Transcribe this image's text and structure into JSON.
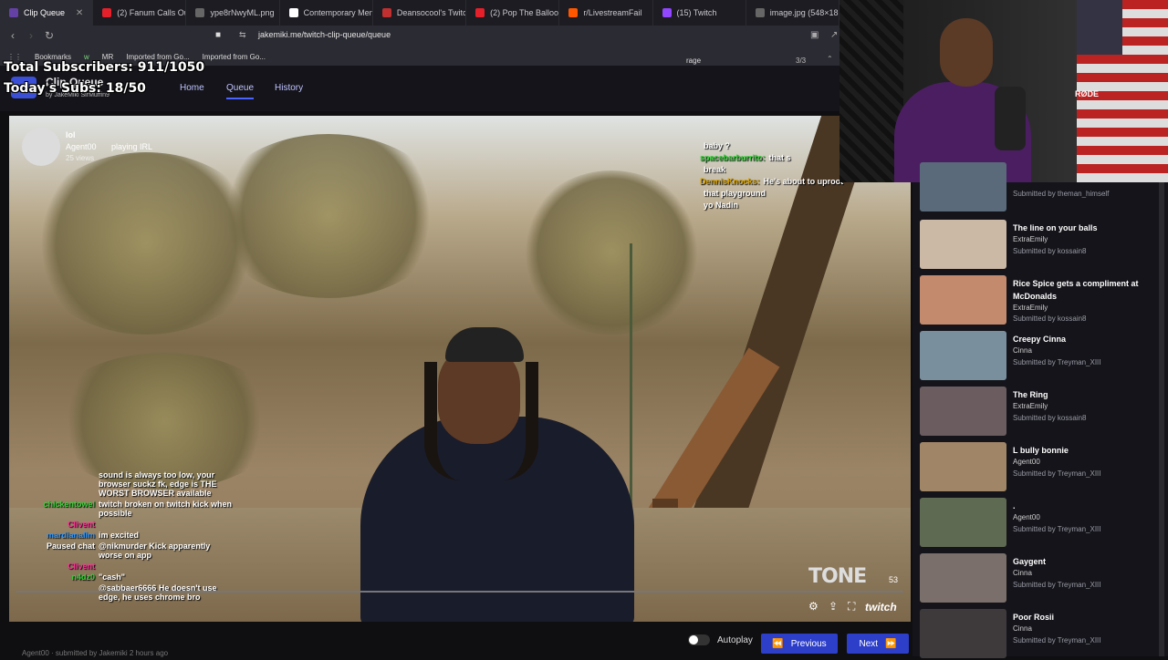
{
  "browser": {
    "tabs": [
      {
        "label": "Clip Queue",
        "color": "#6441a5",
        "active": true
      },
      {
        "label": "(2) Fanum Calls Out",
        "color": "#e5202a"
      },
      {
        "label": "ype8rNwyML.png",
        "color": "#666"
      },
      {
        "label": "Contemporary Men",
        "color": "#ffffff"
      },
      {
        "label": "Deansocool's Twitc",
        "color": "#c03030"
      },
      {
        "label": "(2) Pop The Balloon",
        "color": "#e5202a"
      },
      {
        "label": "r/LivestreamFail",
        "color": "#ff5700"
      },
      {
        "label": "(15) Twitch",
        "color": "#9146ff"
      },
      {
        "label": "image.jpg (548×18",
        "color": "#666"
      }
    ],
    "url": "jakemiki.me/twitch-clip-queue/queue",
    "bookmarks": [
      "Bookmarks",
      "w",
      "MR",
      "Imported from Go...",
      "Imported from Go..."
    ],
    "find": {
      "query": "rage",
      "count": "3/3"
    }
  },
  "overlay": {
    "subscribers": "Total Subscribers: 911/1050",
    "today": "Today's Subs: 18/50"
  },
  "app": {
    "title": "Clip Queue",
    "byline": "by JakeMiki SirMuffin9",
    "nav": {
      "home": "Home",
      "queue": "Queue",
      "history": "History"
    }
  },
  "clip": {
    "title": "lol",
    "channel": "Agent00",
    "category": "playing IRL",
    "views": "25 views",
    "watermark": "TONE",
    "time": "53"
  },
  "chat": [
    {
      "user": "",
      "text": "baby ?",
      "color": "#fff"
    },
    {
      "user": "spacebarburrito:",
      "text": "that s",
      "color": "#36d13a"
    },
    {
      "user": "",
      "text": "break",
      "color": "#fff"
    },
    {
      "user": "DennisKnocks:",
      "text": "He's about to uproot",
      "color": "#d7a100"
    },
    {
      "user": "",
      "text": "that playground",
      "color": "#fff"
    },
    {
      "user": "",
      "text": "yo Nadin",
      "color": "#9d6bff"
    }
  ],
  "chat_left": [
    {
      "user": "",
      "text": "sound is always too low, your browser suckz fk, edge is THE WORST BROWSER available",
      "color": "#fff"
    },
    {
      "user": "chickentowel",
      "text": "twitch broken on twitch kick when possible",
      "color": "#36d13a"
    },
    {
      "user": "Clivent",
      "text": "",
      "color": "#ff3399"
    },
    {
      "user": "mardianalim",
      "text": "im excited",
      "color": "#3399ff"
    },
    {
      "user": "Paused chat",
      "text": "@nikmurder Kick apparently worse on app",
      "color": "#fff"
    },
    {
      "user": "Clivent",
      "text": "",
      "color": "#ff3399"
    },
    {
      "user": "n4dz0",
      "text": "\"cash\"",
      "color": "#36d13a"
    },
    {
      "user": "",
      "text": "@sabbaer6666 He doesn't use edge, he uses chrome bro",
      "color": "#fff"
    }
  ],
  "controls": {
    "autoplay": "Autoplay",
    "previous": "Previous",
    "next": "Next"
  },
  "queue": [
    {
      "title": "",
      "channel": "",
      "submitted": "Submitted by theman_himself",
      "thumb": "#5a6a7a"
    },
    {
      "title": "The line on your balls",
      "channel": "ExtraEmily",
      "submitted": "Submitted by kossain8",
      "thumb": "#cbb9a6"
    },
    {
      "title": "Rice Spice gets a compliment at McDonalds",
      "channel": "ExtraEmily",
      "submitted": "Submitted by kossain8",
      "thumb": "#c48a6e"
    },
    {
      "title": "Creepy Cinna",
      "channel": "Cinna",
      "submitted": "Submitted by Treyman_XIII",
      "thumb": "#7a8f9e"
    },
    {
      "title": "The Ring",
      "channel": "ExtraEmily",
      "submitted": "Submitted by kossain8",
      "thumb": "#6b5c5f"
    },
    {
      "title": "L bully bonnie",
      "channel": "Agent00",
      "submitted": "Submitted by Treyman_XIII",
      "thumb": "#a08566"
    },
    {
      "title": ".",
      "channel": "Agent00",
      "submitted": "Submitted by Treyman_XIII",
      "thumb": "#5f6a52"
    },
    {
      "title": "Gaygent",
      "channel": "Cinna",
      "submitted": "Submitted by Treyman_XIII",
      "thumb": "#7a6f6a"
    },
    {
      "title": "Poor Rosii",
      "channel": "Cinna",
      "submitted": "Submitted by Treyman_XIII",
      "thumb": "#3e3a3c"
    }
  ],
  "webcam": {
    "mic_brand": "RØDE"
  },
  "footer": {
    "submitted_by": "Agent00 · submitted by Jakemiki 2 hours ago"
  }
}
